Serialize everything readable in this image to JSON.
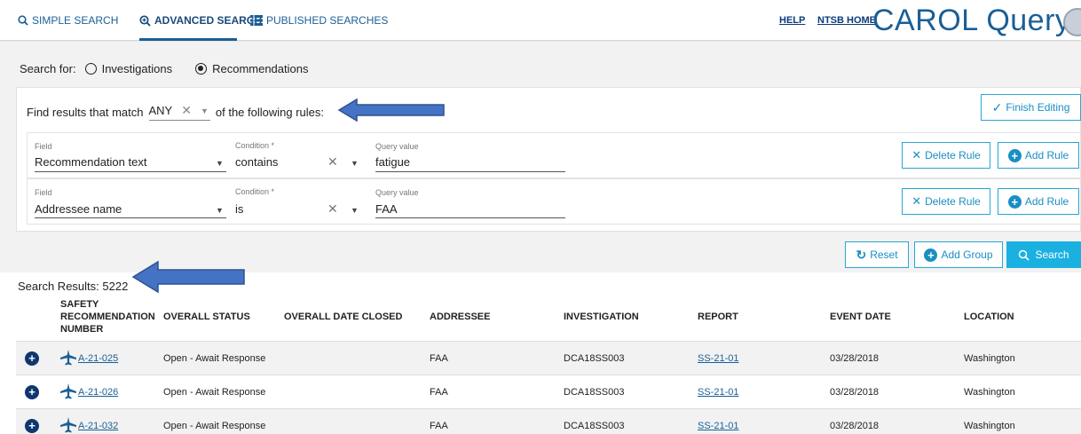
{
  "nav": {
    "simple_search": "SIMPLE SEARCH",
    "advanced_search": "ADVANCED SEARCH",
    "published_searches": "PUBLISHED SEARCHES",
    "help": "HELP",
    "ntsb_home": "NTSB HOME",
    "brand": "CAROL Query"
  },
  "search_for": {
    "label": "Search for:",
    "options": [
      "Investigations",
      "Recommendations"
    ],
    "selected": "Recommendations"
  },
  "rules": {
    "match_prefix": "Find results that match",
    "match_value": "ANY",
    "match_suffix": "of the following rules:",
    "finish_editing": "Finish Editing",
    "rows": [
      {
        "field_label": "Field",
        "field_value": "Recommendation text",
        "condition_label": "Condition *",
        "condition_value": "contains",
        "query_label": "Query value",
        "query_value": "fatigue",
        "delete_label": "Delete Rule",
        "add_label": "Add Rule"
      },
      {
        "field_label": "Field",
        "field_value": "Addressee name",
        "condition_label": "Condition *",
        "condition_value": "is",
        "query_label": "Query value",
        "query_value": "FAA",
        "delete_label": "Delete Rule",
        "add_label": "Add Rule"
      }
    ]
  },
  "actions": {
    "reset": "Reset",
    "add_group": "Add Group",
    "search": "Search"
  },
  "results": {
    "title": "Search Results: 5222",
    "columns": [
      "SAFETY RECOMMENDATION NUMBER",
      "OVERALL STATUS",
      "OVERALL DATE CLOSED",
      "ADDRESSEE",
      "INVESTIGATION",
      "REPORT",
      "EVENT DATE",
      "LOCATION"
    ],
    "rows": [
      {
        "number": "A-21-025",
        "status": "Open - Await Response",
        "date_closed": "",
        "addressee": "FAA",
        "investigation": "DCA18SS003",
        "report": "SS-21-01",
        "event_date": "03/28/2018",
        "location": "Washington"
      },
      {
        "number": "A-21-026",
        "status": "Open - Await Response",
        "date_closed": "",
        "addressee": "FAA",
        "investigation": "DCA18SS003",
        "report": "SS-21-01",
        "event_date": "03/28/2018",
        "location": "Washington"
      },
      {
        "number": "A-21-032",
        "status": "Open - Await Response",
        "date_closed": "",
        "addressee": "FAA",
        "investigation": "DCA18SS003",
        "report": "SS-21-01",
        "event_date": "03/28/2018",
        "location": "Washington"
      }
    ]
  },
  "colors": {
    "accent": "#1ab0e0",
    "nav_blue": "#1a5f96",
    "arrow_fill": "#4472c4",
    "arrow_stroke": "#2f528f",
    "expand_dark": "#0e3770"
  },
  "icons": [
    "search-icon",
    "advanced-search-icon",
    "list-icon",
    "agency-seal",
    "check-icon",
    "close-icon",
    "plus-circle-icon",
    "refresh-icon",
    "airplane-icon"
  ]
}
